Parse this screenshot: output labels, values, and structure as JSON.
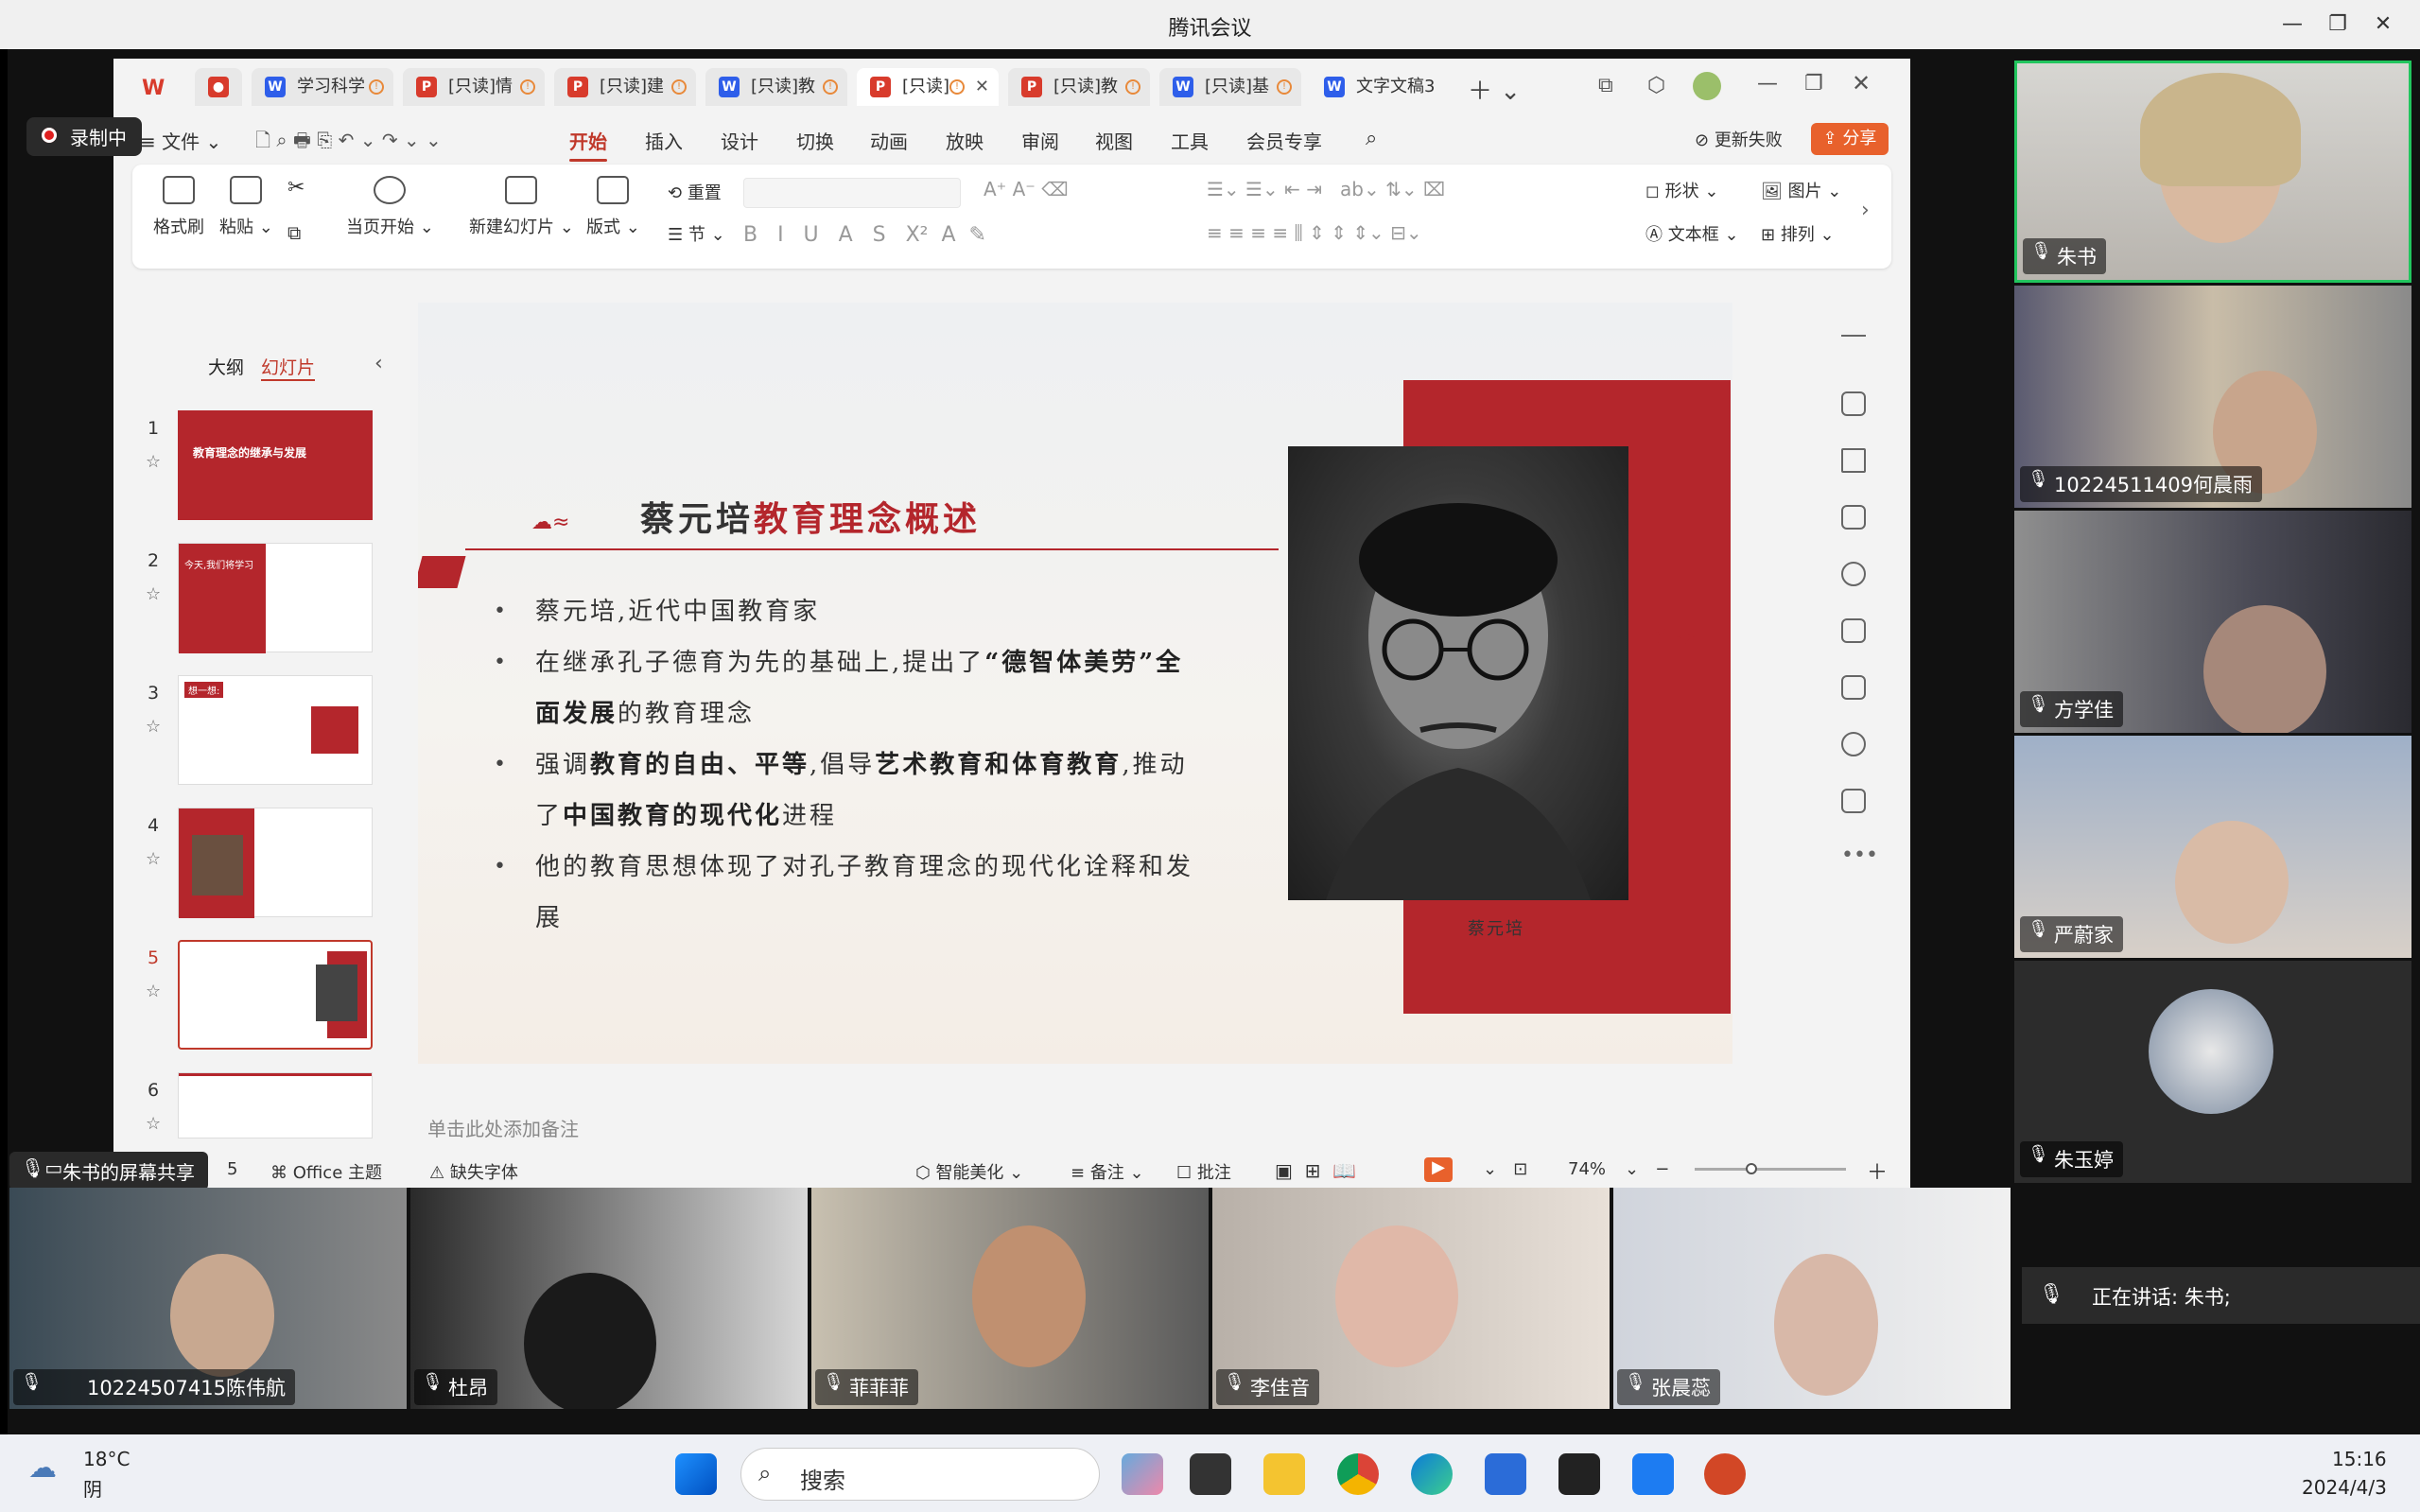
{
  "window": {
    "title": "腾讯会议"
  },
  "meeting": {
    "recording_label": "录制中",
    "screen_share_label": "朱书的屏幕共享",
    "speaking_prefix": "正在讲话: 朱书;",
    "right_participants": [
      "朱书",
      "10224511409何晨雨",
      "方学佳",
      "严蔚家",
      "朱玉婷"
    ],
    "bottom_participants": [
      "10224507415陈伟航",
      "杜昂",
      "菲菲菲",
      "李佳音",
      "张晨蕊"
    ]
  },
  "wps": {
    "tabs": [
      {
        "label": "学习科学",
        "type": "W"
      },
      {
        "label": "[只读]情",
        "type": "P"
      },
      {
        "label": "[只读]建",
        "type": "P"
      },
      {
        "label": "[只读]教",
        "type": "W"
      },
      {
        "label": "[只读]",
        "type": "P"
      },
      {
        "label": "[只读]教",
        "type": "P"
      },
      {
        "label": "[只读]基",
        "type": "W"
      },
      {
        "label": "文字文稿3",
        "type": "W"
      }
    ],
    "file_menu": "文件",
    "menus": [
      "开始",
      "插入",
      "设计",
      "切换",
      "动画",
      "放映",
      "审阅",
      "视图",
      "工具",
      "会员专享"
    ],
    "update_failed": "更新失败",
    "share_btn": "分享",
    "ribbon": {
      "format_painter": "格式刷",
      "paste": "粘贴",
      "from_current": "当页开始",
      "new_slide": "新建幻灯片",
      "layout": "版式",
      "reset": "重置",
      "section": "节",
      "shape": "形状",
      "picture": "图片",
      "textbox": "文本框",
      "arrange": "排列"
    },
    "panel": {
      "outline_tab": "大纲",
      "slides_tab": "幻灯片"
    },
    "slide_numbers": [
      "1",
      "2",
      "3",
      "4",
      "5",
      "6"
    ],
    "thumbs": {
      "t1_title": "教育理念的继承与发展",
      "t2_left": "今天,我们将学习",
      "t3_title": "想一想:"
    },
    "notes_placeholder": "单击此处添加备注",
    "status": {
      "slide_suffix": "5",
      "theme": "Office 主题",
      "missing_font": "缺失字体",
      "smart": "智能美化",
      "notes": "备注",
      "comment": "批注",
      "zoom": "74%"
    }
  },
  "slide": {
    "title_black": "蔡元培",
    "title_red": "教育理念概述",
    "caption": "蔡元培",
    "bullets": [
      {
        "parts": [
          {
            "t": "蔡元培,近代中国教育家",
            "b": false
          }
        ]
      },
      {
        "parts": [
          {
            "t": "在继承孔子德育为先的基础上,提出了",
            "b": false
          },
          {
            "t": "“德智体美劳”全面发展",
            "b": true
          },
          {
            "t": "的教育理念",
            "b": false
          }
        ]
      },
      {
        "parts": [
          {
            "t": "强调",
            "b": false
          },
          {
            "t": "教育的自由、平等",
            "b": true
          },
          {
            "t": ",倡导",
            "b": false
          },
          {
            "t": "艺术教育和体育教育",
            "b": true
          },
          {
            "t": ",推动了",
            "b": false
          },
          {
            "t": "中国教育的现代化",
            "b": true
          },
          {
            "t": "进程",
            "b": false
          }
        ]
      },
      {
        "parts": [
          {
            "t": "他的教育思想体现了对孔子教育理念的现代化诠释和发展",
            "b": false
          }
        ]
      }
    ]
  },
  "taskbar": {
    "weather_temp": "18°C",
    "weather_desc": "阴",
    "search_placeholder": "搜索",
    "time": "15:16",
    "date": "2024/4/3"
  },
  "colors": {
    "accent": "#b4262c",
    "wps_red": "#c0392b",
    "active_border": "#22c55e"
  }
}
